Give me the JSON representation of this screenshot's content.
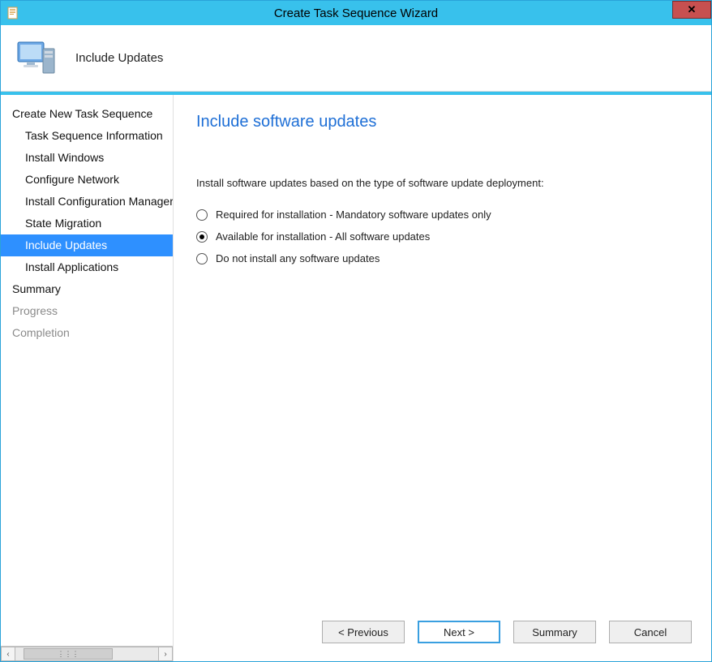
{
  "window": {
    "title": "Create Task Sequence Wizard"
  },
  "header": {
    "step_title": "Include Updates"
  },
  "sidebar": {
    "items": [
      {
        "label": "Create New Task Sequence",
        "sub": false,
        "selected": false,
        "disabled": false
      },
      {
        "label": "Task Sequence Information",
        "sub": true,
        "selected": false,
        "disabled": false
      },
      {
        "label": "Install Windows",
        "sub": true,
        "selected": false,
        "disabled": false
      },
      {
        "label": "Configure Network",
        "sub": true,
        "selected": false,
        "disabled": false
      },
      {
        "label": "Install Configuration Manager",
        "sub": true,
        "selected": false,
        "disabled": false
      },
      {
        "label": "State Migration",
        "sub": true,
        "selected": false,
        "disabled": false
      },
      {
        "label": "Include Updates",
        "sub": true,
        "selected": true,
        "disabled": false
      },
      {
        "label": "Install Applications",
        "sub": true,
        "selected": false,
        "disabled": false
      },
      {
        "label": "Summary",
        "sub": false,
        "selected": false,
        "disabled": false
      },
      {
        "label": "Progress",
        "sub": false,
        "selected": false,
        "disabled": true
      },
      {
        "label": "Completion",
        "sub": false,
        "selected": false,
        "disabled": true
      }
    ]
  },
  "main": {
    "page_title": "Include software updates",
    "instruction": "Install software updates based on the type of software update deployment:",
    "options": [
      {
        "label": "Required for installation - Mandatory software updates only",
        "selected": false
      },
      {
        "label": "Available for installation - All software updates",
        "selected": true
      },
      {
        "label": "Do not install any software updates",
        "selected": false
      }
    ]
  },
  "footer": {
    "previous": "< Previous",
    "next": "Next >",
    "summary": "Summary",
    "cancel": "Cancel"
  }
}
